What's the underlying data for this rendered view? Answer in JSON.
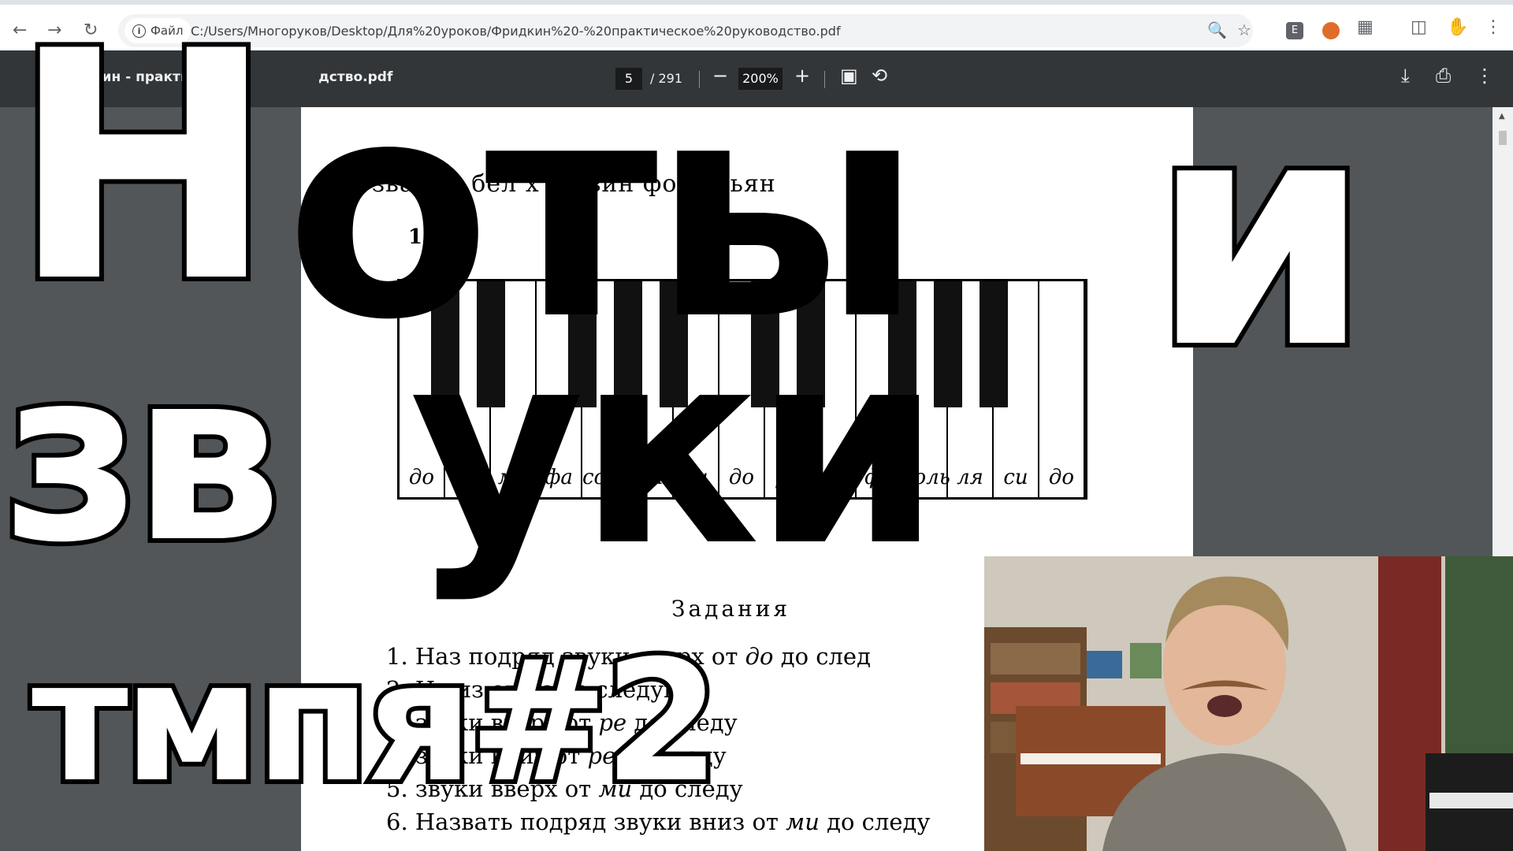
{
  "browser": {
    "site_chip_label": "Файл",
    "url": "C:/Users/Многоруков/Desktop/Для%20уроков/Фридкин%20-%20практическое%20руководство.pdf",
    "extension_letter": "E"
  },
  "pdf_toolbar": {
    "title_visible": "кин - практичес",
    "title_tail": "дство.pdf",
    "current_page": "5",
    "total_pages": "/ 291",
    "zoom": "200%"
  },
  "document": {
    "heading": "Н   звания  бел   х  кл   вин  форте  ьян",
    "figure_number": "1",
    "key_labels": [
      "до",
      "ре",
      "ми",
      "фа",
      "соль",
      "ля",
      "си",
      "до",
      "ре",
      "ми",
      "фа",
      "соль",
      "ля",
      "си",
      "до"
    ],
    "tasks_title": "Задания",
    "tasks": [
      {
        "num": "1.",
        "text_a": "Наз",
        "text_b": " подряд звуки вверх от ",
        "note": "до",
        "text_c": " до след"
      },
      {
        "num": "2.",
        "text_a": "На",
        "text_b": "            из от ",
        "note": "до",
        "text_c": " до следую"
      },
      {
        "num": "3.",
        "text_a": "",
        "text_b": "           звуки вверх от ",
        "note": "ре",
        "text_c": " до следу"
      },
      {
        "num": "4.",
        "text_a": "",
        "text_b": "           звуки вниз от ",
        "note": "ре",
        "text_c": " до следу"
      },
      {
        "num": "5.",
        "text_a": "",
        "text_b": "           звуки вверх от ",
        "note": "ми",
        "text_c": " до следу"
      },
      {
        "num": "6.",
        "text_a": "Назвать",
        "text_b": " подряд звуки вниз от ",
        "note": "ми",
        "text_c": " до следу"
      }
    ]
  },
  "overlay": {
    "line1_left": "Н",
    "line1_mid": "оты",
    "line1_right": "и",
    "line2_left": "зв",
    "line2_mid": "уки",
    "line3": "тмпя#2"
  },
  "colors": {
    "pdf_bg": "#525659",
    "pdf_toolbar": "#323639",
    "browser_bar": "#ffffff"
  }
}
